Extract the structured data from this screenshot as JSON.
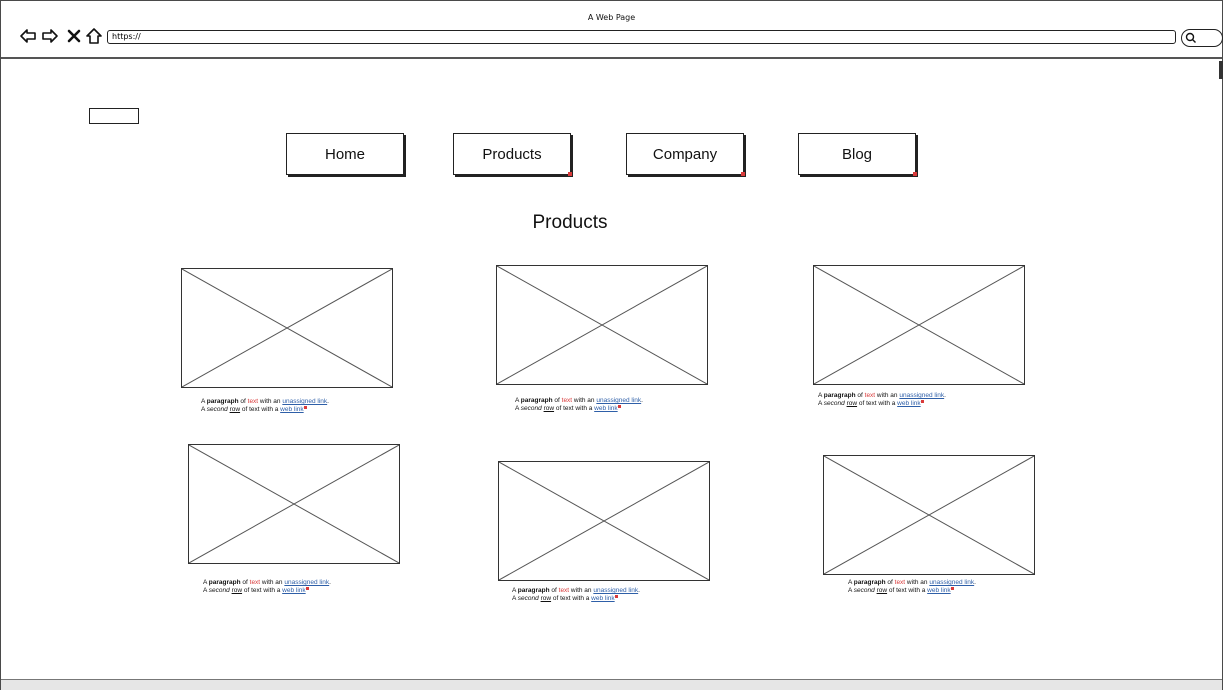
{
  "browser": {
    "window_title": "A Web Page",
    "address": "https://"
  },
  "nav": {
    "items": [
      "Home",
      "Products",
      "Company",
      "Blog"
    ]
  },
  "page": {
    "heading": "Products"
  },
  "caption": {
    "line1_a": "A ",
    "bold": "paragraph",
    "line1_b": " of ",
    "red": "text",
    "line1_c": " with an ",
    "link1": "unassigned link",
    "line1_d": ".",
    "line2_a": "A ",
    "italic": "second",
    "line2_b": " ",
    "row": "row",
    "line2_c": " of text with a ",
    "link2": "web link"
  },
  "colors": {
    "accent_red": "#d93a3a",
    "link_blue": "#2e5fa8"
  }
}
